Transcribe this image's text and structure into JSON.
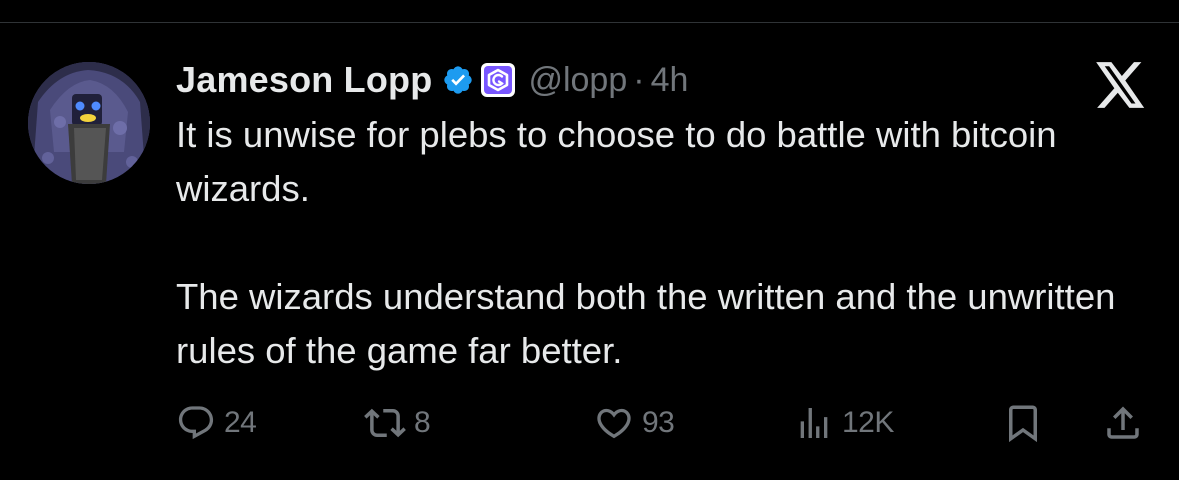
{
  "tweet": {
    "author": {
      "display_name": "Jameson Lopp",
      "handle": "@lopp",
      "verified_badge_icon": "verified-checkmark-icon",
      "affiliate_badge_icon": "affiliate-logo-icon"
    },
    "separator": "·",
    "time": "4h",
    "platform_icon": "x-logo-icon",
    "body": [
      "It is unwise for plebs to choose to do battle with bitcoin wizards.",
      "The wizards understand both the written and the unwritten rules of the game far better."
    ],
    "actions": {
      "replies": {
        "icon": "reply-icon",
        "count": "24"
      },
      "reposts": {
        "icon": "repost-icon",
        "count": "8"
      },
      "likes": {
        "icon": "heart-icon",
        "count": "93"
      },
      "views": {
        "icon": "views-chart-icon",
        "count": "12K"
      },
      "bookmark": {
        "icon": "bookmark-icon"
      },
      "share": {
        "icon": "share-icon"
      }
    }
  },
  "colors": {
    "background": "#000000",
    "text_primary": "#e7e9ea",
    "text_secondary": "#71767b",
    "verified_blue": "#1d9bf0",
    "affiliate_purple": "#7856ff"
  }
}
